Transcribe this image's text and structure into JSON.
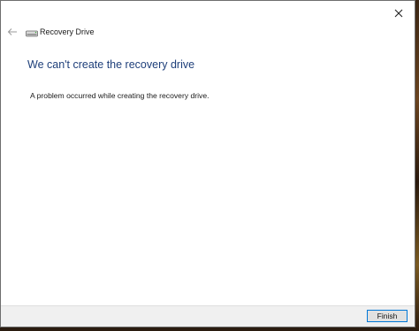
{
  "window": {
    "app_title": "Recovery Drive",
    "heading": "We can't create the recovery drive",
    "message": "A problem occurred while creating the recovery drive.",
    "accent_color": "#1e3f7a"
  },
  "controls": {
    "back_icon": "back-arrow-icon",
    "close_icon": "close-icon",
    "app_icon": "drive-icon"
  },
  "footer": {
    "finish_label": "Finish"
  }
}
